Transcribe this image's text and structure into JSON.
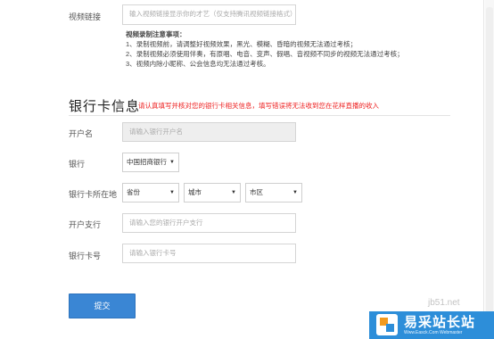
{
  "video_link": {
    "label": "视频链接",
    "placeholder": "输入视频链接显示你的才艺（仅支持腾讯视频链接格式）"
  },
  "notice": {
    "title": "视频录制注意事项：",
    "lines": [
      "1、录制视频前，请调整好视频效果，黑光、模糊、昏暗的视频无法通过考核；",
      "2、录制视频必须使用伴奏，有原唱、电音、变声、假唱、音视频不同步的视频无法通过考核；",
      "3、视频内除小昵称、公会信息均无法通过考核。"
    ]
  },
  "bank_section": {
    "title": "银行卡信息",
    "note": "请认真填写并核对您的银行卡相关信息，填写错误将无法收到您在花样直播的收入"
  },
  "account_name": {
    "label": "开户名",
    "placeholder": "请输入银行开户名"
  },
  "bank": {
    "label": "银行",
    "value": "中国招商银行"
  },
  "location": {
    "label": "银行卡所在地",
    "province": "省份",
    "city": "城市",
    "district": "市区"
  },
  "branch": {
    "label": "开户支行",
    "placeholder": "请输入您的银行开户支行"
  },
  "card_number": {
    "label": "银行卡号",
    "placeholder": "请输入银行卡号"
  },
  "submit": {
    "label": "提交"
  },
  "watermark": {
    "site": "jb51.net",
    "brand": "易采站长站",
    "url": "Www.Easck.Com Webmaster"
  },
  "colors": {
    "primary": "#3a86d4",
    "warning": "#e22222",
    "watermark_blue": "#2d8ed9"
  }
}
